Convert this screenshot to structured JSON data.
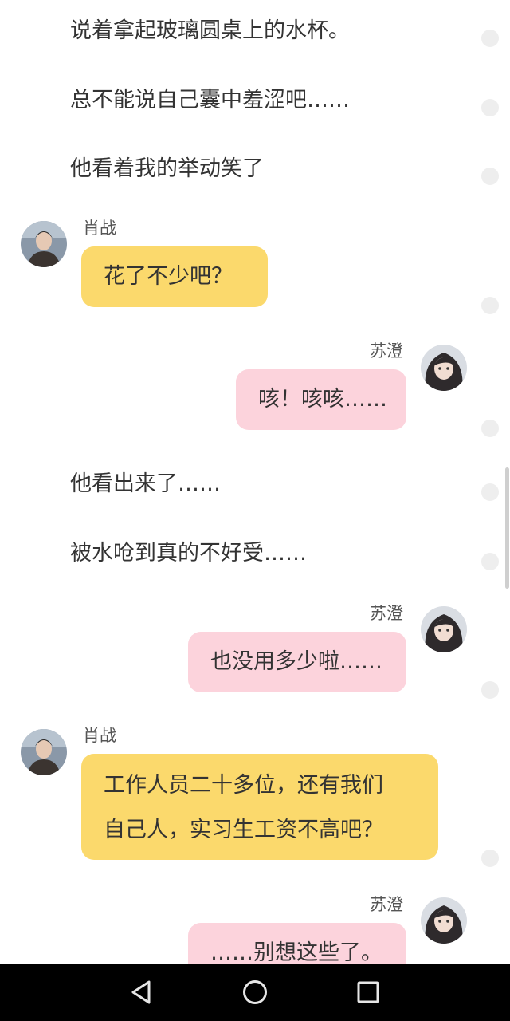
{
  "narration": [
    "说着拿起玻璃圆桌上的水杯。",
    "总不能说自己囊中羞涩吧……",
    "他看着我的举动笑了",
    "他看出来了……",
    "被水呛到真的不好受……"
  ],
  "speakers": {
    "xiao": "肖战",
    "su": "苏澄"
  },
  "messages": {
    "m1": "花了不少吧？",
    "m2": "咳！咳咳……",
    "m3": "也没用多少啦……",
    "m4_line1": "工作人员二十多位，还有我们",
    "m4_line2": "自己人，实习生工资不高吧？",
    "m5": "……别想这些了。"
  },
  "colors": {
    "yellow_bubble": "#fbd96c",
    "pink_bubble": "#fcd3dc",
    "nav_bar": "#000000"
  },
  "icons": {
    "nav_back": "back-triangle-icon",
    "nav_home": "home-circle-icon",
    "nav_recent": "recent-square-icon"
  }
}
